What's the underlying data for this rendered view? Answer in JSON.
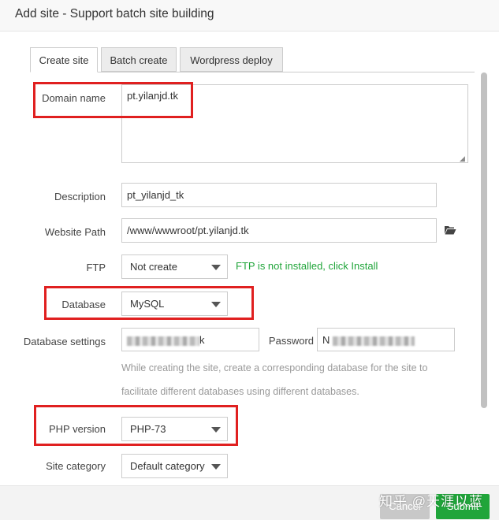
{
  "dialog": {
    "title": "Add site - Support batch site building"
  },
  "tabs": [
    {
      "label": "Create site",
      "active": true
    },
    {
      "label": "Batch create",
      "active": false
    },
    {
      "label": "Wordpress deploy",
      "active": false
    }
  ],
  "form": {
    "domain": {
      "label": "Domain name",
      "value": "pt.yilanjd.tk"
    },
    "description": {
      "label": "Description",
      "value": "pt_yilanjd_tk"
    },
    "website_path": {
      "label": "Website Path",
      "value": "/www/wwwroot/pt.yilanjd.tk",
      "icon": "folder-open-icon"
    },
    "ftp": {
      "label": "FTP",
      "value": "Not create",
      "note": "FTP is not installed, click Install"
    },
    "database": {
      "label": "Database",
      "value": "MySQL"
    },
    "database_settings": {
      "label": "Database settings",
      "username_suffix": "k",
      "password_label": "Password",
      "password_prefix": "N",
      "hint_line1": "While creating the site, create a corresponding database for the site to",
      "hint_line2": "facilitate different databases using different databases."
    },
    "php_version": {
      "label": "PHP version",
      "value": "PHP-73"
    },
    "site_category": {
      "label": "Site category",
      "value": "Default category"
    }
  },
  "footer": {
    "cancel_label": "Cancel",
    "submit_label": "Submit"
  },
  "watermark": "知乎 @天涯以蓝",
  "colors": {
    "accent": "#20a53a",
    "highlight": "#e02020"
  }
}
